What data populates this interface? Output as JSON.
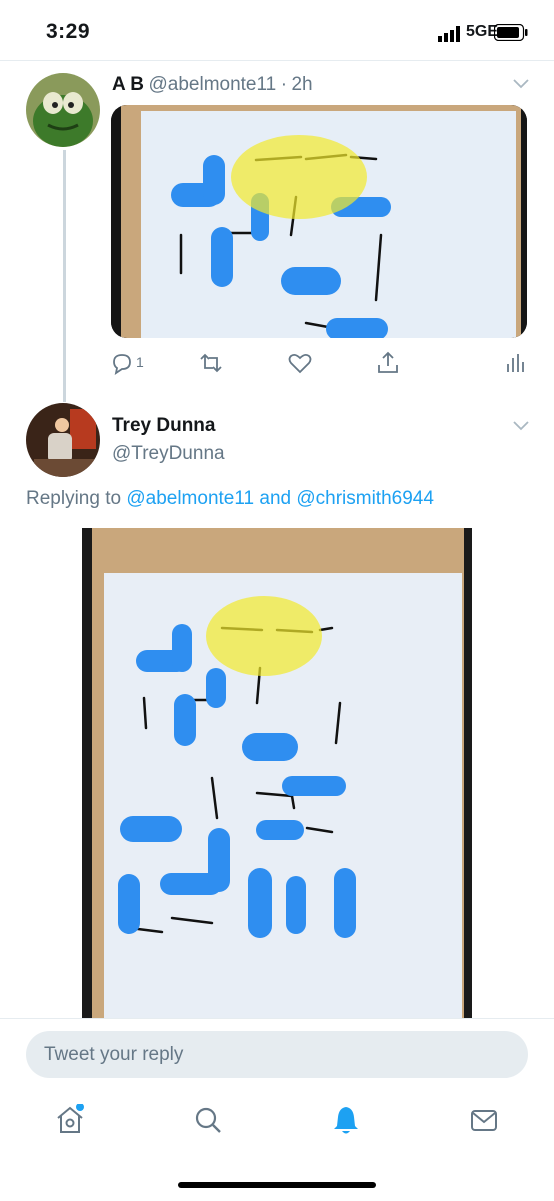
{
  "status_bar": {
    "time": "3:29",
    "network": "5GE"
  },
  "tweet1": {
    "name": "A B",
    "handle": "@abelmonte11",
    "separator": "·",
    "age": "2h",
    "reply_count": "1"
  },
  "tweet2": {
    "name": "Trey Dunna",
    "handle": "@TreyDunna",
    "replying_prefix": "Replying to",
    "replying_user1": "@abelmonte11",
    "replying_and": "and",
    "replying_user2": "@chrismith6944"
  },
  "composer": {
    "placeholder": "Tweet your reply"
  },
  "colors": {
    "accent": "#1da1f2",
    "muted": "#657786",
    "divider": "#e6ecf0"
  },
  "icons": [
    "reply-icon",
    "retweet-icon",
    "like-icon",
    "share-icon",
    "analytics-icon",
    "home-icon",
    "search-icon",
    "notifications-icon",
    "messages-icon"
  ]
}
